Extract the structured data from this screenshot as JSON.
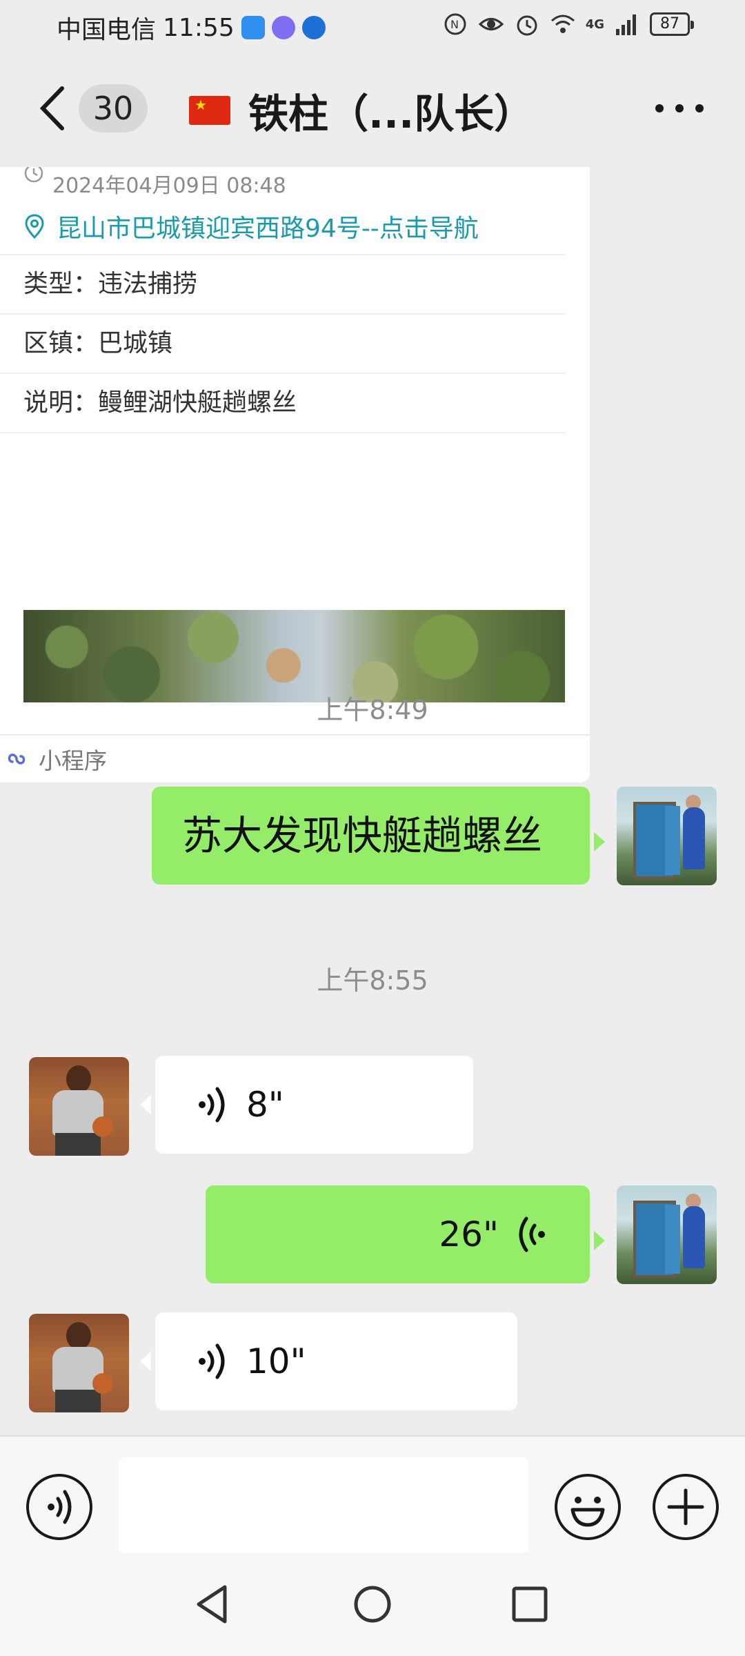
{
  "status_bar": {
    "carrier": "中国电信",
    "time": "11:55",
    "network": "4G",
    "battery": "87"
  },
  "nav": {
    "unread_count": "30",
    "title": "铁柱（...队长）"
  },
  "mini_program_card": {
    "date": "2024年04月09日 08:48",
    "address": "昆山市巴城镇迎宾西路94号--点击导航",
    "rows": [
      {
        "key": "类型：",
        "value": "违法捕捞"
      },
      {
        "key": "区镇：",
        "value": "巴城镇"
      },
      {
        "key": "说明：",
        "value": "鳗鲤湖快艇趟螺丝"
      }
    ],
    "footer_label": "小程序"
  },
  "messages": {
    "time_1": "上午8:49",
    "text_1": "苏大发现快艇趟螺丝",
    "time_2": "上午8:55",
    "voice_1": "8\"",
    "voice_2": "26\"",
    "voice_3": "10\""
  },
  "colors": {
    "bubble_green": "#95ec69",
    "link_teal": "#1a9bab",
    "background": "#ededed"
  },
  "icons": [
    "back-icon",
    "more-icon",
    "location-pin-icon",
    "mini-program-icon",
    "voice-wave-icon",
    "voice-input-icon",
    "emoji-icon",
    "plus-icon"
  ]
}
